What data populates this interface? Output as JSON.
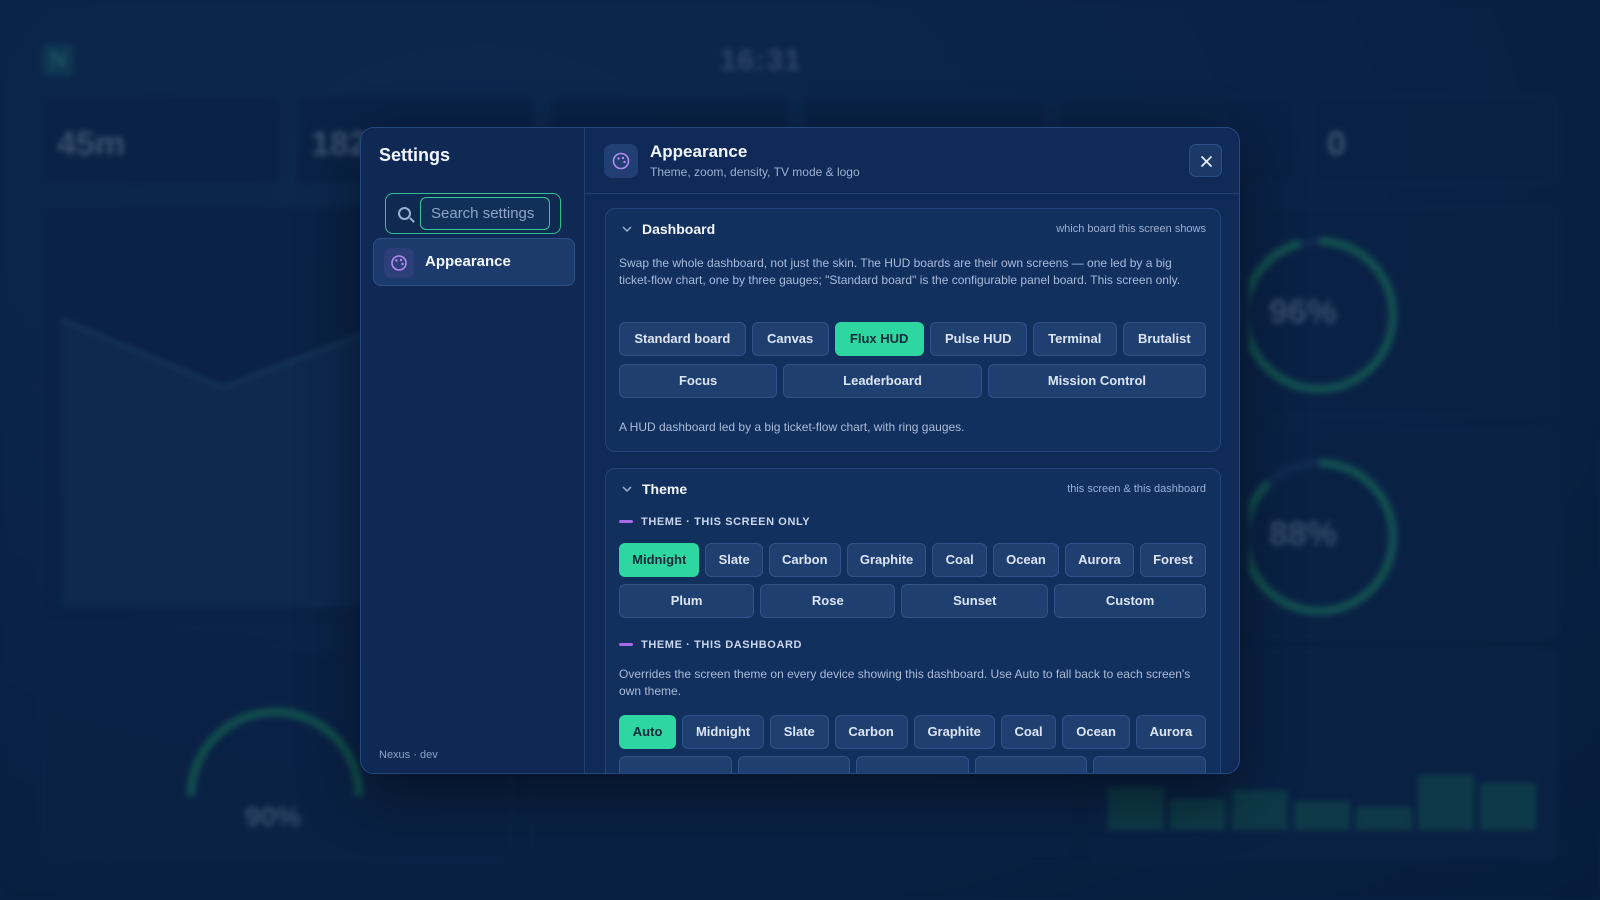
{
  "background": {
    "logo_letter": "N",
    "clock": "16:31",
    "stats": [
      "45m",
      "182",
      "0"
    ],
    "gauges": [
      "96%",
      "88%",
      "90%"
    ],
    "bar_levels": [
      0.72,
      0.52,
      0.66,
      0.48,
      0.38,
      0.92,
      0.78
    ]
  },
  "sidebar": {
    "title": "Settings",
    "search_placeholder": "Search settings",
    "items": [
      {
        "label": "Appearance",
        "icon": "palette-icon"
      }
    ],
    "footer": "Nexus · dev"
  },
  "header": {
    "title": "Appearance",
    "subtitle": "Theme, zoom, density, TV mode & logo",
    "icon": "palette-icon",
    "close_icon": "close-icon"
  },
  "dashboard_section": {
    "title": "Dashboard",
    "hint": "which board this screen shows",
    "description": "Swap the whole dashboard, not just the skin. The HUD boards are their own screens — one led by a big ticket-flow chart, one by three gauges; \"Standard board\" is the configurable panel board. This screen only.",
    "options_row1": [
      "Standard board",
      "Canvas",
      "Flux HUD",
      "Pulse HUD",
      "Terminal",
      "Brutalist"
    ],
    "options_row2": [
      "Focus",
      "Leaderboard",
      "Mission Control"
    ],
    "selected": "Flux HUD",
    "selected_note": "A HUD dashboard led by a big ticket-flow chart, with ring gauges."
  },
  "theme_section": {
    "title": "Theme",
    "hint": "this screen & this dashboard",
    "screen_label": "THEME · THIS SCREEN ONLY",
    "screen_row1": [
      "Midnight",
      "Slate",
      "Carbon",
      "Graphite",
      "Coal",
      "Ocean",
      "Aurora",
      "Forest"
    ],
    "screen_row2": [
      "Plum",
      "Rose",
      "Sunset",
      "Custom"
    ],
    "screen_selected": "Midnight",
    "dashboard_label": "THEME · THIS DASHBOARD",
    "dashboard_description": "Overrides the screen theme on every device showing this dashboard. Use Auto to fall back to each screen's own theme.",
    "dashboard_row1": [
      "Auto",
      "Midnight",
      "Slate",
      "Carbon",
      "Graphite",
      "Coal",
      "Ocean",
      "Aurora"
    ],
    "dashboard_selected": "Auto"
  },
  "colors": {
    "accent": "#2ed6a0",
    "panel": "#0f2a56",
    "sub_accent": "#a76be8"
  }
}
